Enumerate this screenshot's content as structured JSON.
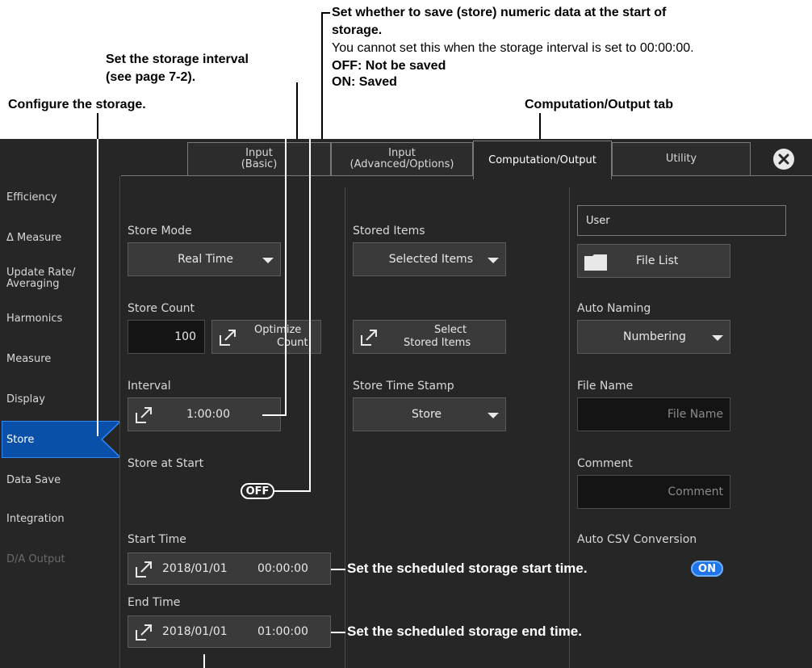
{
  "annotations": {
    "save_numeric_title": "Set whether to save (store) numeric data at the start of",
    "save_numeric_title2": "storage.",
    "save_numeric_note": "You cannot set this when the storage interval is set to 00:00:00.",
    "off_desc": "OFF: Not be saved",
    "on_desc": "ON: Saved",
    "interval_note1": "Set the storage interval",
    "interval_note2": "(see page 7-2).",
    "configure": "Configure the storage.",
    "tab_label": "Computation/Output tab",
    "start_time_note": "Set the scheduled storage start time.",
    "end_time_note": "Set the scheduled storage end time."
  },
  "tabs": [
    {
      "label1": "Input",
      "label2": "(Basic)"
    },
    {
      "label1": "Input",
      "label2": "(Advanced/Options)"
    },
    {
      "label1": "Computation/Output",
      "label2": ""
    },
    {
      "label1": "Utility",
      "label2": ""
    }
  ],
  "sidebar": {
    "items": [
      "Efficiency",
      "Δ Measure",
      "Update Rate/",
      "Averaging",
      "Harmonics",
      "Measure",
      "Display",
      "Store",
      "Data Save",
      "Integration",
      "D/A Output"
    ]
  },
  "col1": {
    "store_mode_label": "Store Mode",
    "store_mode_value": "Real Time",
    "store_count_label": "Store Count",
    "store_count_value": "100",
    "optimize_1": "Optimize",
    "optimize_2": "Count",
    "interval_label": "Interval",
    "interval_value": "1:00:00",
    "store_at_start_label": "Store at Start",
    "store_at_start_value": "OFF",
    "start_time_label": "Start Time",
    "start_time_date": "2018/01/01",
    "start_time_time": "00:00:00",
    "end_time_label": "End Time",
    "end_time_date": "2018/01/01",
    "end_time_time": "01:00:00"
  },
  "col2": {
    "stored_items_label": "Stored Items",
    "stored_items_value": "Selected Items",
    "select_1": "Select",
    "select_2": "Stored Items",
    "time_stamp_label": "Store Time Stamp",
    "time_stamp_value": "Store"
  },
  "col3": {
    "path_value": "User",
    "file_list": "File List",
    "auto_naming_label": "Auto Naming",
    "auto_naming_value": "Numbering",
    "file_name_label": "File Name",
    "file_name_placeholder": "File Name",
    "comment_label": "Comment",
    "comment_placeholder": "Comment",
    "auto_csv_label": "Auto CSV Conversion",
    "auto_csv_value": "ON"
  },
  "colors": {
    "screen_bg": "#262626",
    "active_blue": "#0a4fa8",
    "toggle_on": "#2e86ff"
  }
}
